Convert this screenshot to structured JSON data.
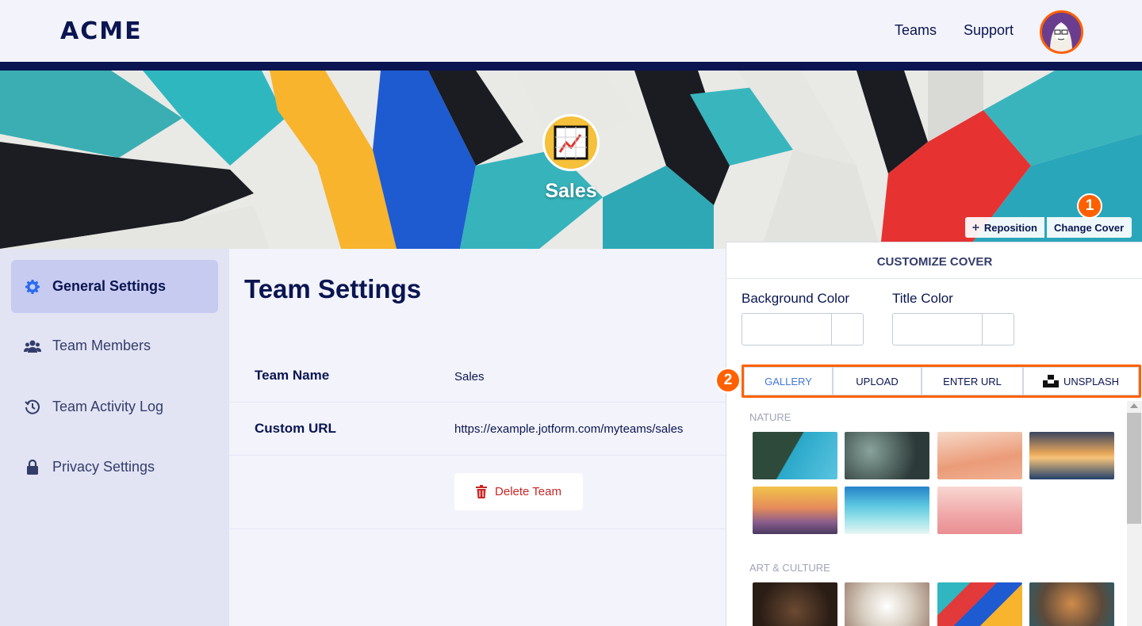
{
  "header": {
    "logo": "ACME",
    "nav": [
      "Teams",
      "Support"
    ]
  },
  "cover": {
    "team_name": "Sales",
    "reposition_label": "Reposition",
    "change_cover_label": "Change Cover"
  },
  "badges": [
    "1",
    "2"
  ],
  "sidebar": {
    "items": [
      {
        "label": "General Settings",
        "icon": "gear-icon",
        "active": true
      },
      {
        "label": "Team Members",
        "icon": "users-icon"
      },
      {
        "label": "Team Activity Log",
        "icon": "history-icon"
      },
      {
        "label": "Privacy Settings",
        "icon": "lock-icon"
      }
    ]
  },
  "main": {
    "title": "Team Settings",
    "rows": [
      {
        "label": "Team Name",
        "value": "Sales"
      },
      {
        "label": "Custom URL",
        "value": "https://example.jotform.com/myteams/sales"
      }
    ],
    "delete_label": "Delete Team"
  },
  "customize": {
    "title": "CUSTOMIZE COVER",
    "background_color_label": "Background Color",
    "title_color_label": "Title Color",
    "tabs": [
      "GALLERY",
      "UPLOAD",
      "ENTER URL",
      "UNSPLASH"
    ],
    "active_tab": "GALLERY",
    "sections": [
      "NATURE",
      "ART & CULTURE"
    ]
  },
  "colors": {
    "navy": "#0a1551",
    "accent_orange": "#ff6100",
    "active_tab_blue": "#4277d8",
    "delete_red": "#c92525"
  }
}
